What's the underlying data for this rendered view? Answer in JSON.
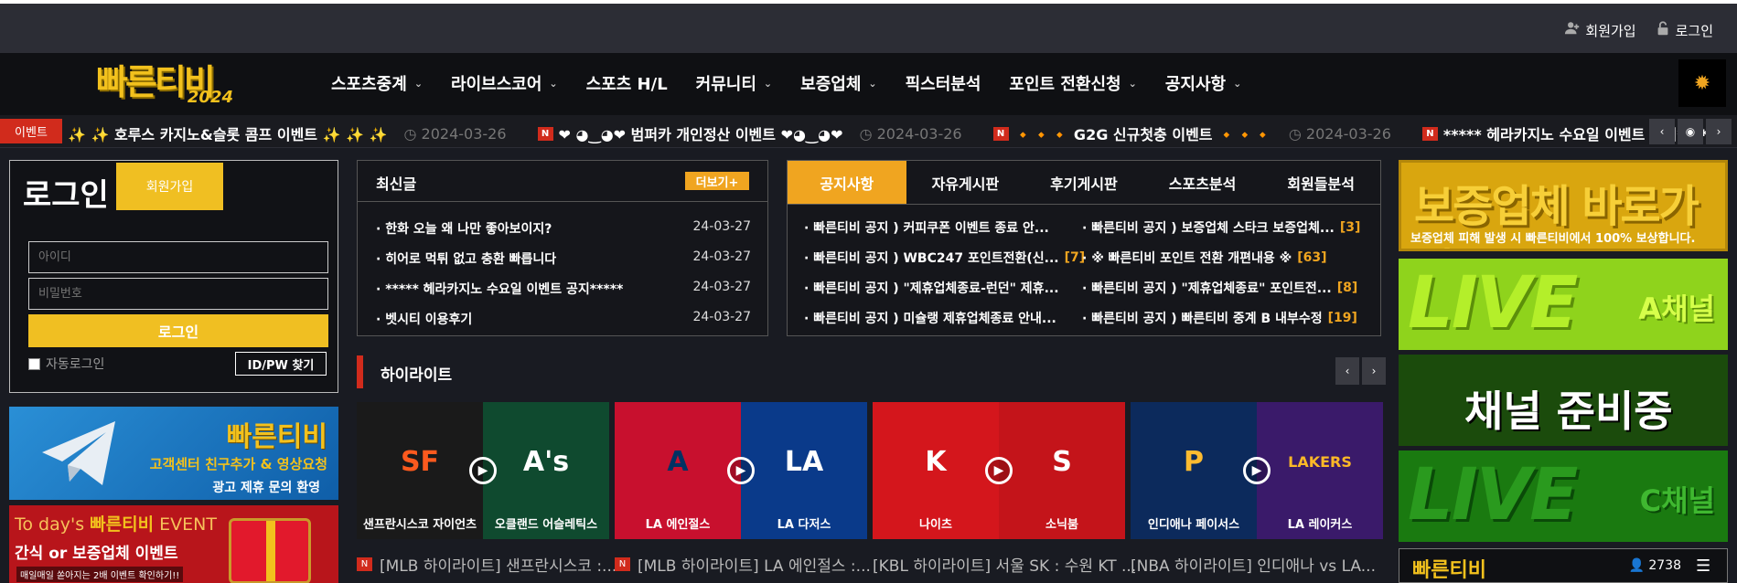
{
  "topbar": {
    "signup": "회원가입",
    "login": "로그인"
  },
  "header": {
    "logo_main": "빠른티비",
    "logo_year": "2024",
    "nav": [
      {
        "label": "스포츠중계",
        "dropdown": true
      },
      {
        "label": "라이브스코어",
        "dropdown": true
      },
      {
        "label": "스포츠 H/L",
        "dropdown": false
      },
      {
        "label": "커뮤니티",
        "dropdown": true
      },
      {
        "label": "보증업체",
        "dropdown": true
      },
      {
        "label": "픽스터분석",
        "dropdown": false
      },
      {
        "label": "포인트 전환신청",
        "dropdown": true
      },
      {
        "label": "공지사항",
        "dropdown": true
      }
    ],
    "theme_icon": "sun-icon"
  },
  "ticker": {
    "badge": "이벤트",
    "items": [
      {
        "title": "✨ ✨ 호루스 카지노&슬롯 콤프 이벤트 ✨ ✨ ✨",
        "date": "2024-03-26",
        "new": false
      },
      {
        "title": "❤ ◕‿◕❤ 범퍼카 개인정산 이벤트 ❤◕‿◕❤",
        "date": "2024-03-26",
        "new": true
      },
      {
        "title": "🔸🔸🔸 G2G 신규첫충 이벤트 🔸🔸🔸",
        "date": "2024-03-26",
        "new": true
      },
      {
        "title": "***** 헤라카지노 수요일 이벤트 공지*****",
        "date": "",
        "new": true
      }
    ],
    "new_label": "N"
  },
  "login": {
    "title": "로그인",
    "join_tab": "회원가입",
    "id_placeholder": "아이디",
    "pw_placeholder": "비밀번호",
    "submit": "로그인",
    "auto_login": "자동로그인",
    "find": "ID/PW 찾기"
  },
  "left_banners": {
    "telegram": {
      "brand": "빠른티비",
      "line1": "고객센터 친구추가 & 영상요청",
      "line2": "광고 제휴 문의 환영"
    },
    "event": {
      "line1_prefix": "To day's ",
      "line1_brand": "빠른티비",
      "line1_suffix": " EVENT",
      "line2": "간식 or 보증업체 이벤트",
      "line3": "매일매일 쏟아지는 2배 이벤트 확인하기!!"
    }
  },
  "latest": {
    "title": "최신글",
    "more": "더보기+",
    "posts": [
      {
        "title": "· 한화 오늘 왜 나만 좋아보이지?",
        "date": "24-03-27"
      },
      {
        "title": "· 히어로 먹튀 없고 충환 빠릅니다",
        "date": "24-03-27"
      },
      {
        "title": "· ***** 헤라카지노 수요일 이벤트 공지*****",
        "date": "24-03-27"
      },
      {
        "title": "· 벳시티 이용후기",
        "date": "24-03-27"
      }
    ]
  },
  "notice": {
    "tabs": [
      "공지사항",
      "자유게시판",
      "후기게시판",
      "스포츠분석",
      "회원들분석"
    ],
    "left": [
      {
        "title": "· 빠른티비 공지 ) 커피쿠폰 이벤트 종료 안...",
        "count": ""
      },
      {
        "title": "· 빠른티비 공지 ) WBC247 포인트전환(신...",
        "count": "[7]"
      },
      {
        "title": "· 빠른티비 공지 ) \"제휴업체종료-런던\" 제휴...",
        "count": ""
      },
      {
        "title": "· 빠른티비 공지 ) 미슐랭 제휴업체종료 안내...",
        "count": ""
      }
    ],
    "right": [
      {
        "title": "· 빠른티비 공지 ) 보증업체 스타크 보증업체...",
        "count": "[3]"
      },
      {
        "title": "· ※ 빠른티비 포인트 전환 개편내용 ※",
        "count": "[63]"
      },
      {
        "title": "· 빠른티비 공지 ) \"제휴업체종료\" 포인트전...",
        "count": "[8]"
      },
      {
        "title": "· 빠른티비 공지 ) 빠른티비 중계 B 내부수정",
        "count": "[19]"
      }
    ]
  },
  "highlight": {
    "title": "하이라이트",
    "cards": [
      {
        "home": "샌프란시스코 자이언츠",
        "away": "오클랜드 어슬레틱스",
        "home_abbr": "SF",
        "away_abbr": "A's",
        "home_color": "#1a1a1a",
        "away_color": "#0f4a2f",
        "home_logo_color": "#fd5a1e",
        "away_logo_color": "#ffffff",
        "caption": "[MLB 하이라이트] 샌프란시스코 :...",
        "new": true
      },
      {
        "home": "LA 에인절스",
        "away": "LA 다저스",
        "home_abbr": "A",
        "away_abbr": "LA",
        "home_color": "#c8102e",
        "away_color": "#0a3a8a",
        "home_logo_color": "#003263",
        "away_logo_color": "#ffffff",
        "caption": "[MLB 하이라이트] LA 에인절스 :...",
        "new": true
      },
      {
        "home": "나이츠",
        "away": "소닉붐",
        "home_abbr": "K",
        "away_abbr": "S",
        "home_color": "#d4161c",
        "away_color": "#c4141a",
        "home_logo_color": "#ffffff",
        "away_logo_color": "#ffffff",
        "caption": "[KBL 하이라이트] 서울 SK : 수원 KT ...",
        "new": false
      },
      {
        "home": "인디애나 페이서스",
        "away": "LA 레이커스",
        "home_abbr": "P",
        "away_abbr": "LAKERS",
        "home_color": "#0c2a5c",
        "away_color": "#3a1a6a",
        "home_logo_color": "#fdbb30",
        "away_logo_color": "#fdb927",
        "caption": "[NBA 하이라이트] 인디애나 vs LA...",
        "new": false
      }
    ]
  },
  "right_banners": {
    "guarantee": {
      "title": "보증업체 바로가기",
      "sub": "보증업체 피해 발생 시 빠른티비에서 100% 보상합니다."
    },
    "live_a": {
      "live": "LIVE",
      "channel": "A채널"
    },
    "preparing": "채널 준비중",
    "live_c": {
      "live": "LIVE",
      "channel": "C채널"
    },
    "footer_logo": "빠른티비",
    "user_count": "2738"
  }
}
